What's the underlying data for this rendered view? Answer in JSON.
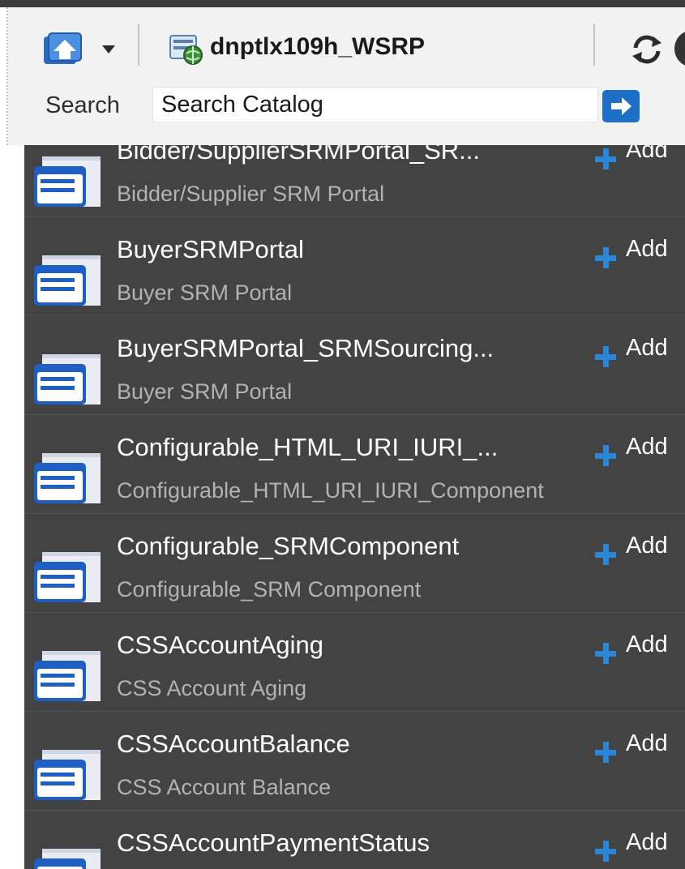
{
  "toolbar": {
    "server_name": "dnptlx109h_WSRP",
    "home_icon": "home-upload-icon",
    "caret_icon": "chevron-down-icon",
    "server_icon": "server-globe-icon",
    "refresh_icon": "refresh-icon"
  },
  "search": {
    "label": "Search",
    "value": "Search Catalog",
    "go_icon": "arrow-right-icon"
  },
  "colors": {
    "list_bg": "#434343",
    "accent": "#1e6fc8",
    "toolbar_bg": "#f2f2f2"
  },
  "catalog": {
    "add_label": "Add",
    "items": [
      {
        "title": "Bidder/SupplierSRMPortal_SR...",
        "subtitle": "Bidder/Supplier SRM Portal"
      },
      {
        "title": "BuyerSRMPortal",
        "subtitle": "Buyer SRM Portal"
      },
      {
        "title": "BuyerSRMPortal_SRMSourcing...",
        "subtitle": "Buyer SRM Portal"
      },
      {
        "title": "Configurable_HTML_URI_IURI_...",
        "subtitle": "Configurable_HTML_URI_IURI_Component"
      },
      {
        "title": "Configurable_SRMComponent",
        "subtitle": "Configurable_SRM Component"
      },
      {
        "title": "CSSAccountAging",
        "subtitle": "CSS Account Aging"
      },
      {
        "title": "CSSAccountBalance",
        "subtitle": "CSS Account Balance"
      },
      {
        "title": "CSSAccountPaymentStatus",
        "subtitle": ""
      }
    ]
  }
}
